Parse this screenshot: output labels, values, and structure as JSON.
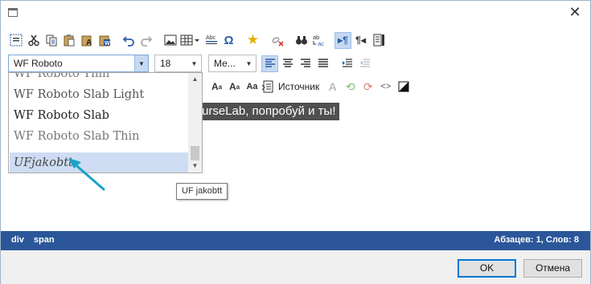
{
  "window": {
    "close_label": "✕"
  },
  "toolbar1": {
    "buttons": [
      {
        "name": "select-all-icon",
        "glyph": "▦"
      },
      {
        "name": "cut-icon",
        "glyph": "✂"
      },
      {
        "name": "copy-icon",
        "glyph": "⧉"
      },
      {
        "name": "paste-icon",
        "glyph": "📋"
      },
      {
        "name": "paste-text-icon",
        "glyph": "A"
      },
      {
        "name": "paste-word-icon",
        "glyph": "W"
      },
      {
        "name": "undo-icon",
        "glyph": "↶"
      },
      {
        "name": "redo-icon",
        "glyph": "↷"
      },
      {
        "name": "image-icon",
        "glyph": "▣"
      },
      {
        "name": "table-icon",
        "glyph": "▤"
      },
      {
        "name": "horizontal-rule-icon",
        "glyph": "☰"
      },
      {
        "name": "special-char-icon",
        "glyph": "Ω"
      },
      {
        "name": "bookmark-star-icon",
        "glyph": "★"
      },
      {
        "name": "unlink-icon",
        "glyph": "⛓"
      },
      {
        "name": "find-icon",
        "glyph": "🔭"
      },
      {
        "name": "replace-icon",
        "glyph": "ab"
      },
      {
        "name": "paragraph-ltr-icon",
        "glyph": "¶"
      },
      {
        "name": "paragraph-rtl-icon",
        "glyph": "¶"
      },
      {
        "name": "fullscreen-icon",
        "glyph": "▯"
      }
    ]
  },
  "font_combo": {
    "value": "WF Roboto"
  },
  "size_combo": {
    "value": "18"
  },
  "style_combo": {
    "value": "Ме..."
  },
  "toolbar3": {
    "source_label": "Источник"
  },
  "editor": {
    "visible_text": "urseLab, попробуй и ты!"
  },
  "font_list": {
    "items": [
      {
        "label": "WF Roboto Thin",
        "style": "light"
      },
      {
        "label": "WF Roboto Slab Light",
        "style": "normal"
      },
      {
        "label": "WF Roboto Slab",
        "style": "bold"
      },
      {
        "label": "WF Roboto Slab Thin",
        "style": "light"
      },
      {
        "label": "UFjakobtt",
        "style": "selected"
      }
    ]
  },
  "tooltip": {
    "text": "UF jakobtt"
  },
  "statusbar": {
    "path": [
      "div",
      "span"
    ],
    "stats": "Абзацев: 1, Слов: 8"
  },
  "footer": {
    "ok_label": "OK",
    "cancel_label": "Отмена"
  },
  "colors": {
    "accent": "#2b579a",
    "selection": "#cddcf2",
    "arrow": "#1aa3c7"
  }
}
